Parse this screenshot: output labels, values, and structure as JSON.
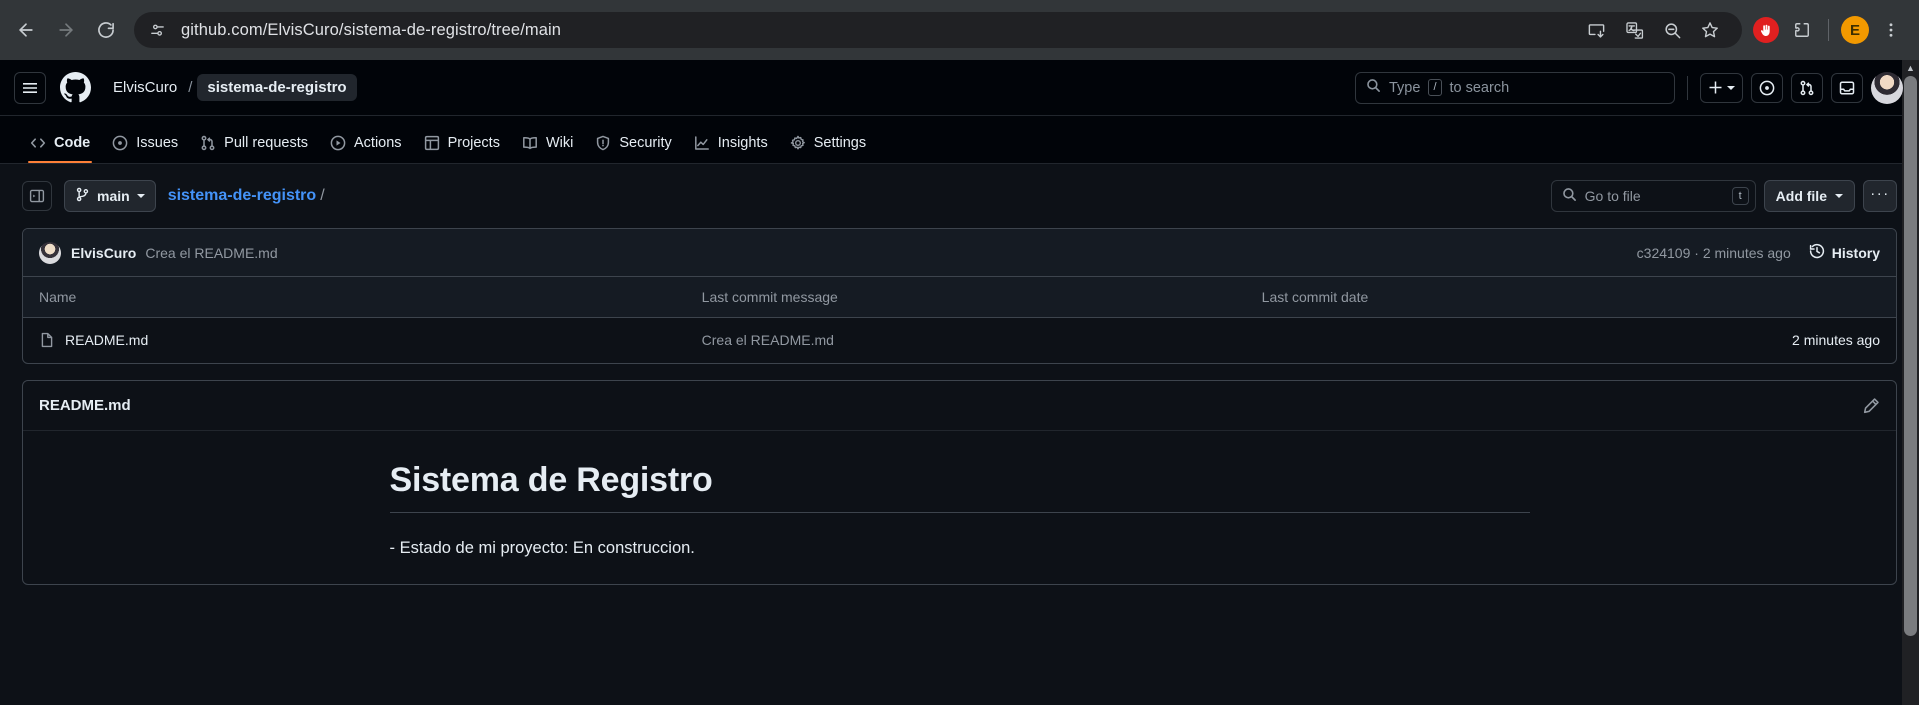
{
  "browser": {
    "back_icon": "arrow-left-icon",
    "forward_icon": "arrow-right-icon",
    "reload_icon": "reload-icon",
    "site_info_icon": "site-settings-icon",
    "url": "github.com/ElvisCuro/sistema-de-registro/tree/main",
    "actions": [
      {
        "name": "install-app-icon",
        "label": "Install app"
      },
      {
        "name": "translate-icon",
        "label": "Translate this page"
      },
      {
        "name": "zoom-out-icon",
        "label": "Zoom"
      },
      {
        "name": "bookmark-star-icon",
        "label": "Bookmark this tab"
      }
    ],
    "extension_stop_label": "✋",
    "extensions_icon": "extensions-puzzle-icon",
    "profile_initial": "E",
    "menu_icon": "three-dot-menu-icon"
  },
  "gh_header": {
    "menu_icon": "hamburger-menu-icon",
    "logo_icon": "github-mark-icon",
    "owner": "ElvisCuro",
    "separator": "/",
    "repo": "sistema-de-registro",
    "search_placeholder": "Type",
    "search_kbd": "/",
    "search_suffix": "to search",
    "create_new_label": "+",
    "issues_icon": "issues-icon",
    "pull_requests_icon": "pull-requests-icon",
    "inbox_icon": "inbox-icon",
    "avatar_name": "user-avatar"
  },
  "repo_nav": {
    "tabs": [
      {
        "label": "Code",
        "icon": "code-icon",
        "active": true
      },
      {
        "label": "Issues",
        "icon": "issue-opened-icon",
        "active": false
      },
      {
        "label": "Pull requests",
        "icon": "git-pull-request-icon",
        "active": false
      },
      {
        "label": "Actions",
        "icon": "play-circle-icon",
        "active": false
      },
      {
        "label": "Projects",
        "icon": "table-icon",
        "active": false
      },
      {
        "label": "Wiki",
        "icon": "book-icon",
        "active": false
      },
      {
        "label": "Security",
        "icon": "shield-icon",
        "active": false
      },
      {
        "label": "Insights",
        "icon": "graph-icon",
        "active": false
      },
      {
        "label": "Settings",
        "icon": "gear-icon",
        "active": false
      }
    ],
    "active_underline_color": "#fd7f37"
  },
  "file_toolbar": {
    "sidebar_toggle_icon": "sidebar-expand-icon",
    "branch_icon": "git-branch-icon",
    "branch_name": "main",
    "path_repo": "sistema-de-registro",
    "path_separator": "/",
    "goto_file_placeholder": "Go to file",
    "goto_file_kbd": "t",
    "add_file_label": "Add file",
    "more_label": "···"
  },
  "commit_bar": {
    "author": "ElvisCuro",
    "message": "Crea el README.md",
    "hash_and_time": "c324109 · 2 minutes ago",
    "history_label": "History",
    "history_icon": "history-clock-icon"
  },
  "file_table": {
    "columns": [
      "Name",
      "Last commit message",
      "Last commit date"
    ],
    "rows": [
      {
        "icon": "file-icon",
        "name": "README.md",
        "message": "Crea el README.md",
        "date": "2 minutes ago"
      }
    ]
  },
  "readme": {
    "title": "README.md",
    "edit_icon": "pencil-edit-icon",
    "heading": "Sistema de Registro",
    "paragraph": "- Estado de mi proyecto: En construccion."
  },
  "colors": {
    "page_bg": "#0d1117",
    "header_bg": "#010409",
    "panel_border": "#3d444d",
    "link_blue": "#4493f8",
    "muted_text": "#9198a1",
    "accent_orange": "#fd7f37",
    "browser_chrome": "#323639"
  }
}
